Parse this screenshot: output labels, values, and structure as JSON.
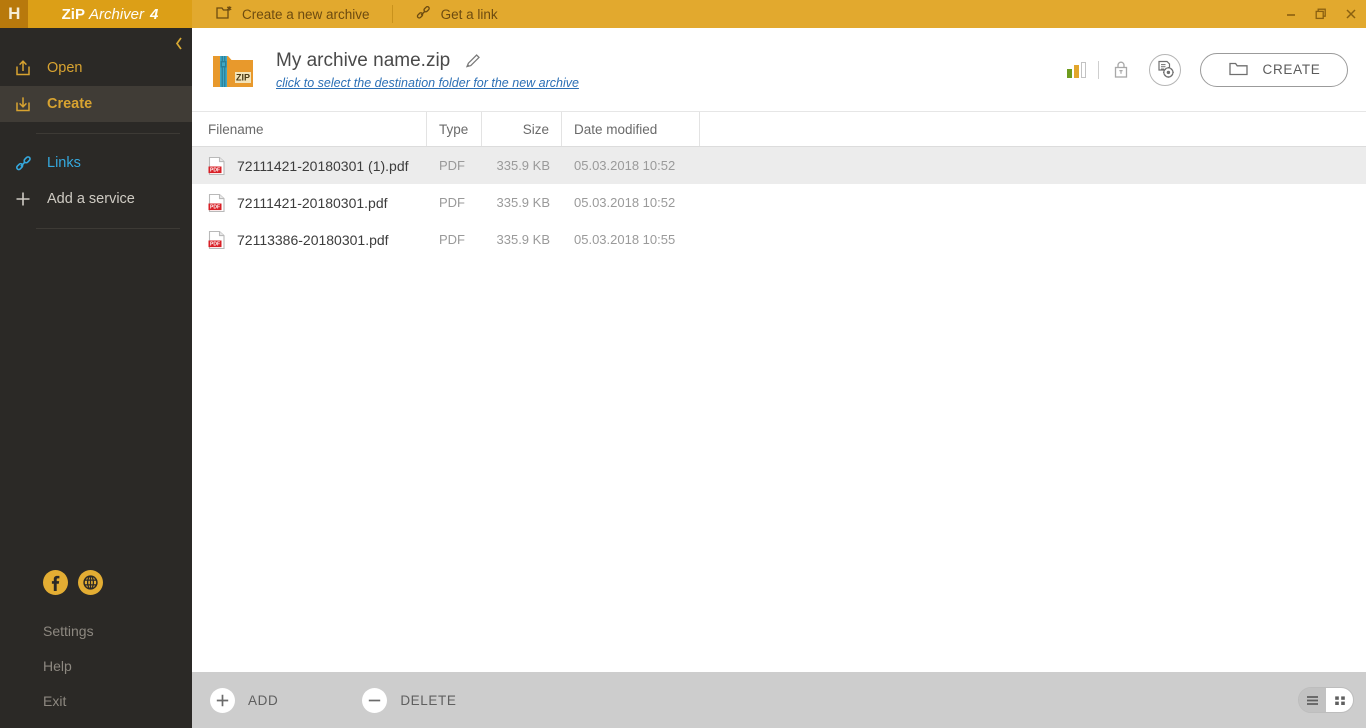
{
  "titlebar": {
    "logo": "H",
    "brand": {
      "part1": "ZiP",
      "part2": "Archiver",
      "part3": "4"
    },
    "tabs": [
      {
        "label": "Create a new archive",
        "icon": "new-folder-icon"
      },
      {
        "label": "Get a link",
        "icon": "link-icon"
      }
    ],
    "window_controls": [
      {
        "name": "minimize",
        "glyph": "—"
      },
      {
        "name": "restore",
        "glyph": "❐"
      },
      {
        "name": "close",
        "glyph": "✕"
      }
    ]
  },
  "sidebar": {
    "collapse_glyph": "‹",
    "items": [
      {
        "label": "Open",
        "icon": "open-archive-icon",
        "state": "normal"
      },
      {
        "label": "Create",
        "icon": "create-archive-icon",
        "state": "active"
      },
      {
        "label": "Links",
        "icon": "chain-link-icon",
        "state": "link"
      },
      {
        "label": "Add a service",
        "icon": "plus-icon",
        "state": "plain"
      }
    ],
    "social": [
      {
        "name": "facebook-icon",
        "glyph": "f"
      },
      {
        "name": "globe-icon",
        "glyph": "⊕"
      }
    ],
    "footer": [
      {
        "label": "Settings"
      },
      {
        "label": "Help"
      },
      {
        "label": "Exit"
      }
    ]
  },
  "archive": {
    "icon": "zip-folder-icon",
    "badge": "ZIP",
    "name": "My archive name.zip",
    "edit_icon": "pencil-icon",
    "destination_link": "click to select the destination folder for the new archive",
    "compression_icon": "compression-level-icon",
    "lock_icon": "lock-icon",
    "settings_icon": "archive-settings-gear-icon",
    "create_button": "CREATE",
    "create_icon": "folder-icon",
    "compression_bars": [
      {
        "height": 10,
        "color": "#6e9c1e"
      },
      {
        "height": 14,
        "color": "#e2a62c"
      },
      {
        "height": 16,
        "color": "#ffffff"
      }
    ]
  },
  "table": {
    "columns": [
      "Filename",
      "Type",
      "Size",
      "Date modified"
    ],
    "rows": [
      {
        "filename": "72111421-20180301 (1).pdf",
        "type": "PDF",
        "size": "335.9 KB",
        "date": "05.03.2018 10:52",
        "selected": true
      },
      {
        "filename": "72111421-20180301.pdf",
        "type": "PDF",
        "size": "335.9 KB",
        "date": "05.03.2018 10:52",
        "selected": false
      },
      {
        "filename": "72113386-20180301.pdf",
        "type": "PDF",
        "size": "335.9 KB",
        "date": "05.03.2018 10:55",
        "selected": false
      }
    ]
  },
  "bottombar": {
    "add_label": "ADD",
    "delete_label": "DELETE",
    "add_icon": "plus-circle-icon",
    "delete_icon": "minus-circle-icon",
    "view_list_icon": "list-view-icon",
    "view_grid_icon": "grid-view-icon"
  },
  "colors": {
    "titlebar": "#e2a92e",
    "brand": "#dc9f17",
    "logo": "#b8790c",
    "sidebar": "#2b2926",
    "accent_gold": "#d8a330",
    "link_blue": "#35a8dd",
    "bottombar": "#cdcdcd",
    "row_selected": "#ececec"
  }
}
